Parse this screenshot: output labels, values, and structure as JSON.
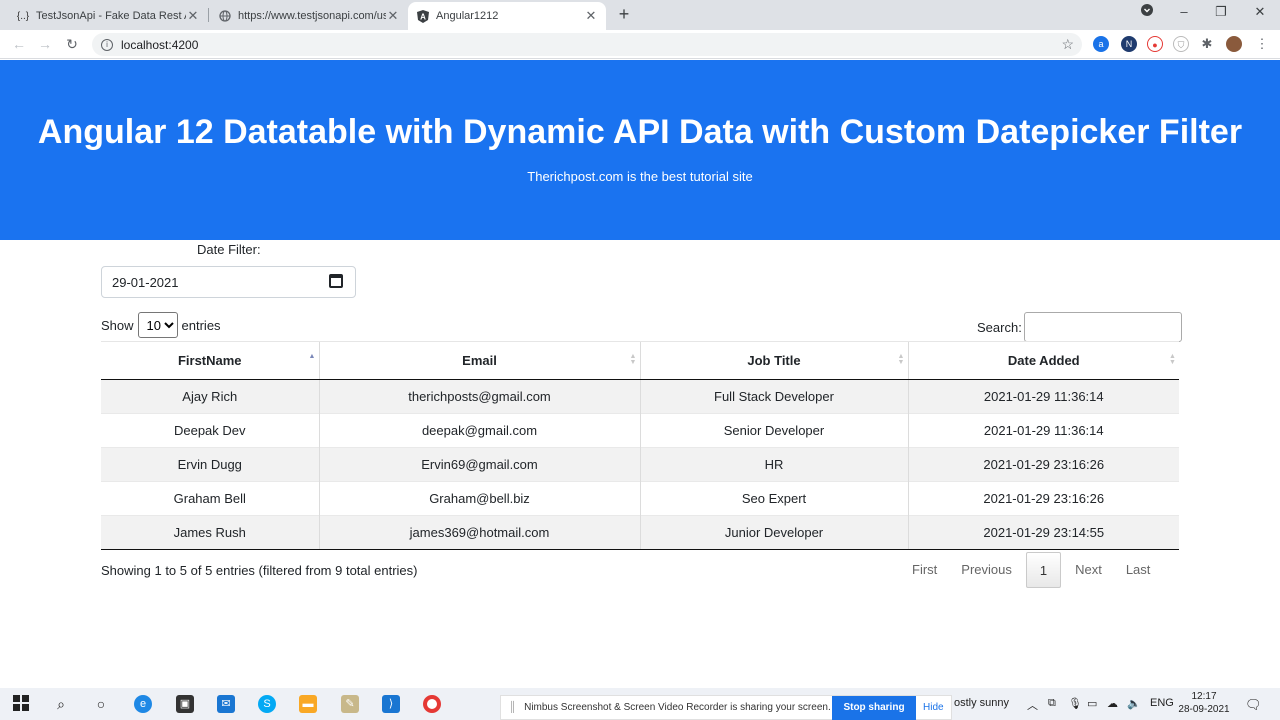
{
  "browser": {
    "tabs": [
      {
        "icon": "json-icon",
        "title": "TestJsonApi - Fake Data Rest API"
      },
      {
        "icon": "globe-icon",
        "title": "https://www.testjsonapi.com/users"
      },
      {
        "icon": "angular-icon",
        "title": "Angular1212"
      }
    ],
    "address": "localhost:4200"
  },
  "hero": {
    "title": "Angular 12 Datatable with Dynamic API Data with Custom Datepicker Filter",
    "subtitle": "Therichpost.com is the best tutorial site",
    "color": "#1a73f0"
  },
  "filter": {
    "label": "Date Filter:",
    "value": "29-01-2021"
  },
  "table_controls": {
    "show": "Show",
    "page_size": "10",
    "entries": "entries",
    "search_label": "Search:"
  },
  "table": {
    "columns": [
      "FirstName",
      "Email",
      "Job Title",
      "Date Added"
    ],
    "rows": [
      [
        "Ajay Rich",
        "therichposts@gmail.com",
        "Full Stack Developer",
        "2021-01-29 11:36:14"
      ],
      [
        "Deepak Dev",
        "deepak@gmail.com",
        "Senior Developer",
        "2021-01-29 11:36:14"
      ],
      [
        "Ervin Dugg",
        "Ervin69@gmail.com",
        "HR",
        "2021-01-29 23:16:26"
      ],
      [
        "Graham Bell",
        "Graham@bell.biz",
        "Seo Expert",
        "2021-01-29 23:16:26"
      ],
      [
        "James Rush",
        "james369@hotmail.com",
        "Junior Developer",
        "2021-01-29 23:14:55"
      ]
    ]
  },
  "info": "Showing 1 to 5 of 5 entries (filtered from 9 total entries)",
  "pagination": {
    "first": "First",
    "previous": "Previous",
    "current": "1",
    "next": "Next",
    "last": "Last"
  },
  "taskbar": {
    "share_message": "Nimbus Screenshot & Screen Video Recorder is sharing your screen.",
    "stop_label": "Stop sharing",
    "hide_label": "Hide",
    "weather": "ostly sunny",
    "lang": "ENG",
    "time": "12:17",
    "date": "28-09-2021"
  }
}
